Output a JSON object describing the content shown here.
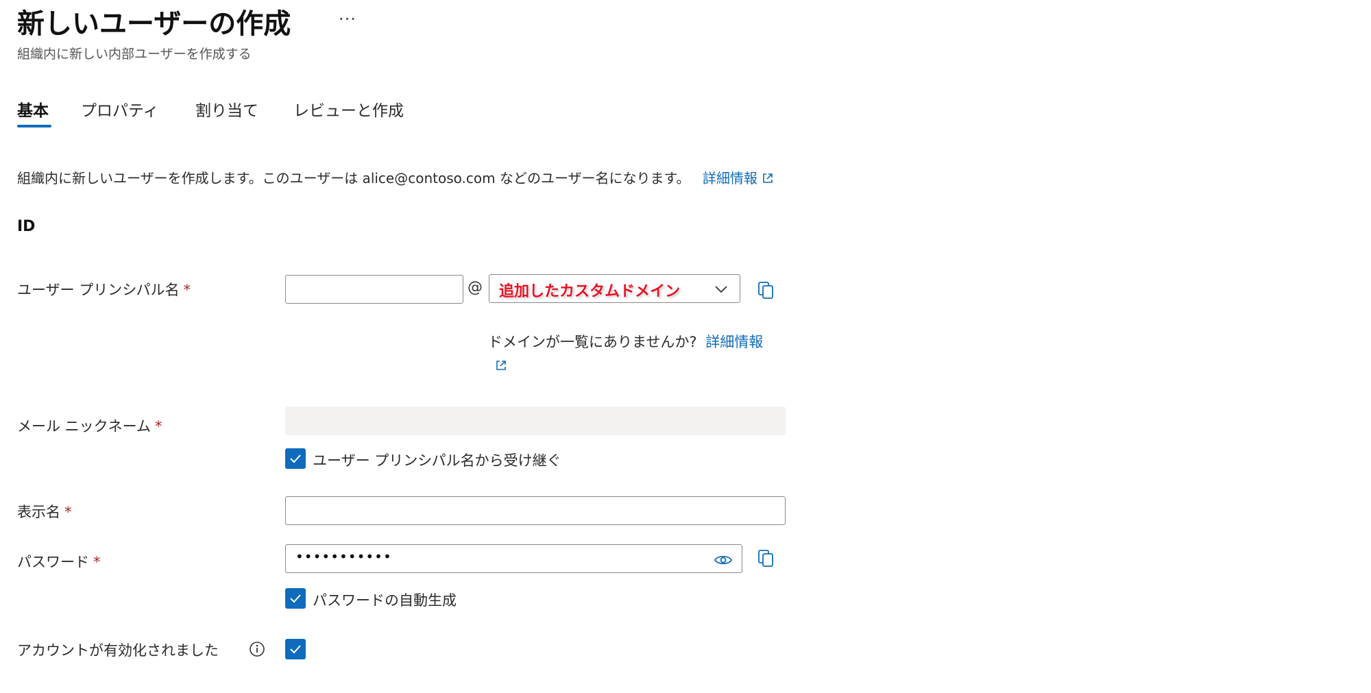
{
  "header": {
    "title": "新しいユーザーの作成",
    "more": "···",
    "subtitle": "組織内に新しい内部ユーザーを作成する"
  },
  "tabs": [
    {
      "label": "基本",
      "active": true
    },
    {
      "label": "プロパティ",
      "active": false
    },
    {
      "label": "割り当て",
      "active": false
    },
    {
      "label": "レビューと作成",
      "active": false
    }
  ],
  "description": {
    "text": "組織内に新しいユーザーを作成します。このユーザーは alice@contoso.com などのユーザー名になります。",
    "link": "詳細情報"
  },
  "section_title": "ID",
  "form": {
    "upn": {
      "label": "ユーザー プリンシパル名",
      "required_mark": "*",
      "value": "",
      "at_sign": "@",
      "domain_selected": "追加したカスタムドメイン",
      "hint": "ドメインが一覧にありませんか?",
      "hint_link": "詳細情報"
    },
    "mail_nickname": {
      "label": "メール ニックネーム",
      "required_mark": "*",
      "value": "",
      "inherit_checkbox_label": "ユーザー プリンシパル名から受け継ぐ",
      "inherit_checked": true
    },
    "display_name": {
      "label": "表示名",
      "required_mark": "*",
      "value": ""
    },
    "password": {
      "label": "パスワード",
      "required_mark": "*",
      "masked_value": "•••••••••••",
      "autogen_checkbox_label": "パスワードの自動生成",
      "autogen_checked": true
    },
    "account_enabled": {
      "label": "アカウントが有効化されました",
      "checked": true
    }
  },
  "colors": {
    "accent": "#0f6cbd",
    "required": "#a4262c",
    "annotation": "#e81123"
  }
}
